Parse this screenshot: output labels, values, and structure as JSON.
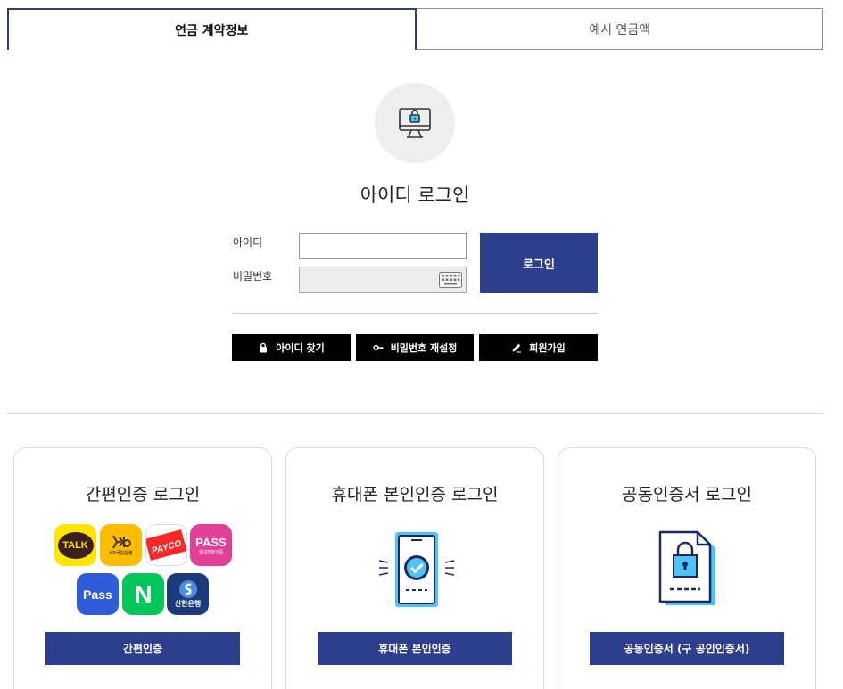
{
  "tabs": [
    {
      "label": "연금 계약정보",
      "active": true
    },
    {
      "label": "예시 연금액",
      "active": false
    }
  ],
  "login": {
    "icon": "monitor-lock-icon",
    "title": "아이디 로그인",
    "id_label": "아이디",
    "pw_label": "비밀번호",
    "id_value": "",
    "pw_value": "",
    "login_button": "로그인",
    "keyboard_icon": "virtual-keyboard-icon"
  },
  "actions": [
    {
      "label": "아이디 찾기",
      "icon": "lock-icon"
    },
    {
      "label": "비밀번호 재설정",
      "icon": "key-icon"
    },
    {
      "label": "회원가입",
      "icon": "pencil-icon"
    }
  ],
  "cards": [
    {
      "title": "간편인증 로그인",
      "button": "간편인증",
      "apps": [
        {
          "name": "kakao-talk",
          "text": "TALK",
          "bg": "#fee500",
          "fg": "#3c1e1e"
        },
        {
          "name": "kb-bank",
          "text": "KB국민은행",
          "bg": "#ffbc00",
          "fg": "#5a4a3a"
        },
        {
          "name": "payco",
          "text": "PAYCO",
          "bg": "#ffffff",
          "fg": "#ffffff",
          "accent": "#fa2828"
        },
        {
          "name": "pass-app",
          "text": "PASS",
          "sub": "휴대전화인증",
          "bg": "#e43f96",
          "fg": "#ffffff"
        },
        {
          "name": "pass-blue",
          "text": "Pass",
          "bg": "#2f5bd8",
          "fg": "#ffffff"
        },
        {
          "name": "naver",
          "text": "N",
          "bg": "#03c75a",
          "fg": "#ffffff"
        },
        {
          "name": "shinhan",
          "text": "신한은행",
          "bg": "#1c3a7a",
          "fg": "#ffffff"
        }
      ]
    },
    {
      "title": "휴대폰 본인인증 로그인",
      "button": "휴대폰 본인인증",
      "icon": "phone-check-icon"
    },
    {
      "title": "공동인증서 로그인",
      "button": "공동인증서 (구 공인인증서)",
      "icon": "certificate-lock-icon"
    }
  ],
  "colors": {
    "primary": "#2d3e8c",
    "black_button": "#000000",
    "accent_blue": "#4fc3f7",
    "navy": "#1b2a5c"
  }
}
